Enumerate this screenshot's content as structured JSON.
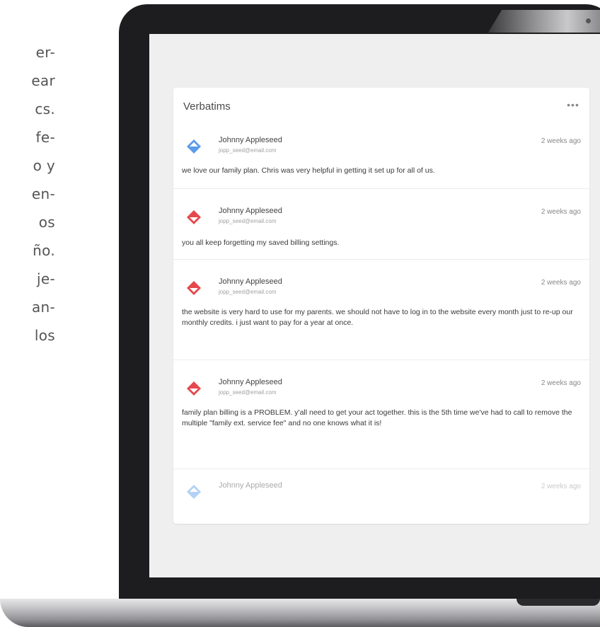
{
  "side_text": [
    "er-",
    "ear",
    "cs.",
    "fe-",
    "o y",
    "en-",
    "os",
    "ño.",
    "je-",
    "an-",
    "los"
  ],
  "card": {
    "title": "Verbatims",
    "more_label": "•••",
    "entries": [
      {
        "name": "Johnny Appleseed",
        "email": "jopp_seed@email.com",
        "time": "2 weeks ago",
        "comment": "we love our family plan.  Chris was very helpful in getting it set up for all of us.",
        "icon": "diamond-positive-icon",
        "color": "#4a90e2"
      },
      {
        "name": "Johnny Appleseed",
        "email": "jopp_seed@email.com",
        "time": "2 weeks ago",
        "comment": "you all keep forgetting my saved billing settings.",
        "icon": "diamond-negative-icon",
        "color": "#e5484d"
      },
      {
        "name": "Johnny Appleseed",
        "email": "jopp_seed@email.com",
        "time": "2 weeks ago",
        "comment": "the website is very hard to use for my parents.  we should not have to log in to the website every month just to re-up our monthly credits.  i just want to pay for a year at once.",
        "icon": "diamond-negative-icon",
        "color": "#e5484d"
      },
      {
        "name": "Johnny Appleseed",
        "email": "jopp_seed@email.com",
        "time": "2 weeks ago",
        "comment": "family plan billing is a PROBLEM.  y'all need to get your act together.  this is the 5th time we've had to call to remove the multiple \"family ext. service fee\" and no one knows what it is!",
        "icon": "diamond-negative-icon",
        "color": "#e5484d"
      },
      {
        "name": "Johnny Appleseed",
        "email": "",
        "time": "2 weeks ago",
        "comment": "",
        "icon": "diamond-positive-icon",
        "color": "#4a90e2"
      }
    ]
  }
}
